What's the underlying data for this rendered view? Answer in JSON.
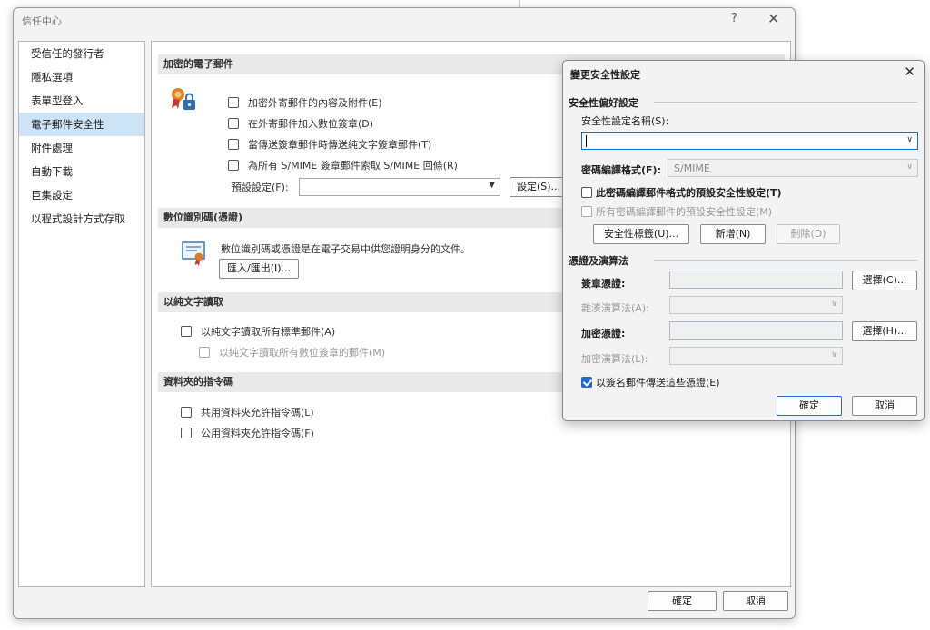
{
  "trust_center": {
    "title": "信任中心",
    "help": "?",
    "close": "✕",
    "sidebar": [
      {
        "label": "受信任的發行者",
        "selected": false
      },
      {
        "label": "隱私選項",
        "selected": false
      },
      {
        "label": "表單型登入",
        "selected": false
      },
      {
        "label": "電子郵件安全性",
        "selected": true
      },
      {
        "label": "附件處理",
        "selected": false
      },
      {
        "label": "自動下載",
        "selected": false
      },
      {
        "label": "巨集設定",
        "selected": false
      },
      {
        "label": "以程式設計方式存取",
        "selected": false
      }
    ],
    "sections": {
      "encrypted": {
        "header": "加密的電子郵件",
        "options": [
          "加密外寄郵件的內容及附件(E)",
          "在外寄郵件加入數位簽章(D)",
          "當傳送簽章郵件時傳送純文字簽章郵件(T)",
          "為所有 S/MIME 簽章郵件索取 S/MIME 回條(R)"
        ],
        "default_setting_label": "預設設定(F):",
        "settings_button": "設定(S)..."
      },
      "digital_id": {
        "header": "數位識別碼(憑證)",
        "description": "數位識別碼或憑證是在電子交易中供您證明身分的文件。",
        "import_export_button": "匯入/匯出(I)..."
      },
      "plain_text": {
        "header": "以純文字讀取",
        "options": [
          "以純文字讀取所有標準郵件(A)",
          "以純文字讀取所有數位簽章的郵件(M)"
        ]
      },
      "folder_script": {
        "header": "資料夾的指令碼",
        "options": [
          "共用資料夾允許指令碼(L)",
          "公用資料夾允許指令碼(F)"
        ]
      }
    },
    "footer": {
      "ok": "確定",
      "cancel": "取消"
    }
  },
  "dialog": {
    "title": "變更安全性設定",
    "close": "✕",
    "prefs_group": "安全性偏好設定",
    "name_label": "安全性設定名稱(S):",
    "name_value": "",
    "crypto_label": "密碼編譯格式(F):",
    "crypto_value": "S/MIME",
    "default_for_format": "此密碼編譯郵件格式的預設安全性設定(T)",
    "default_for_all": "所有密碼編譯郵件的預設安全性設定(M)",
    "labels_button": "安全性標籤(U)...",
    "new_button": "新增(N)",
    "delete_button": "刪除(D)",
    "certs_group": "憑證及演算法",
    "signing_cert_label": "簽章憑證:",
    "hash_label": "雜湊演算法(A):",
    "encrypt_cert_label": "加密憑證:",
    "encrypt_alg_label": "加密演算法(L):",
    "choose_c": "選擇(C)...",
    "choose_h": "選擇(H)...",
    "send_certs": "以簽名郵件傳送這些憑證(E)",
    "ok": "確定",
    "cancel": "取消"
  },
  "colors": {
    "accent": "#1f6ad0",
    "selected_bg": "#cde4f7",
    "header_bg": "#e9e9e9"
  }
}
